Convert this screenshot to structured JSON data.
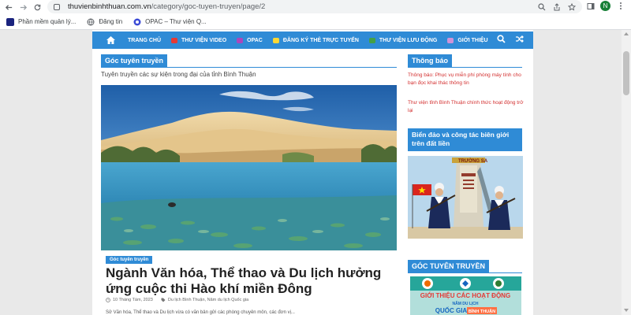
{
  "browser": {
    "url_host": "thuvienbinhthuan.com.vn",
    "url_path": "/category/goc-tuyen-truyen/page/2",
    "profile_initial": "N",
    "bookmarks": [
      {
        "label": "Phần mềm quản lý...",
        "color": "#1a237e"
      },
      {
        "label": "Đăng tin",
        "color": "#5f6368"
      },
      {
        "label": "OPAC – Thư viện Q...",
        "color": "#3c4bd6"
      }
    ]
  },
  "nav": {
    "items": [
      {
        "label": "TRANG CHỦ",
        "color": ""
      },
      {
        "label": "THƯ VIỆN VIDEO",
        "color": "#e53935"
      },
      {
        "label": "OPAC",
        "color": "#ab47bc"
      },
      {
        "label": "ĐĂNG KÝ THẺ TRỰC TUYẾN",
        "color": "#fdd835"
      },
      {
        "label": "THƯ VIỆN LƯU ĐỘNG",
        "color": "#43a047"
      },
      {
        "label": "GIỚI THIỆU",
        "color": "#ce93d8"
      }
    ]
  },
  "main": {
    "section_title": "Góc tuyên truyền",
    "intro": "Tuyên truyền các sự kiện trong đại của tỉnh Bình Thuận",
    "post": {
      "category": "Góc tuyên truyền",
      "title": "Ngành Văn hóa, Thể thao và Du lịch hưởng ứng cuộc thi Hào khí miền Đông",
      "date": "10 Tháng Tám, 2023",
      "tags": "Du lịch Bình Thuận, Năm du lịch Quốc gia",
      "excerpt": "Sở Văn hóa, Thể thao và Du lịch vừa có văn bản gửi các phòng chuyên môn, các đơn vị..."
    }
  },
  "sidebar": {
    "notice_title": "Thông báo",
    "notices": [
      "Thông báo: Phục vụ miễn phí phòng máy tính cho bạn đọc khai thác thông tin",
      "Thư viện tỉnh Bình Thuận chính thức hoạt động trở lại"
    ],
    "sea_title": "Biển đảo và công tác biên giới trên đất liền",
    "sea_monument": "TRƯỜNG SA",
    "goc_title": "GÓC TUYÊN TRUYỀN",
    "banner_line1": "GIỚI THIỆU CÁC HOẠT ĐỘNG",
    "banner_line2": "NĂM DU LỊCH",
    "banner_line3": "QUỐC GIA",
    "banner_line4": "BÌNH THUẬN"
  },
  "colors": {
    "brand_blue": "#2f8bd6",
    "notice_red": "#d32f2f"
  }
}
